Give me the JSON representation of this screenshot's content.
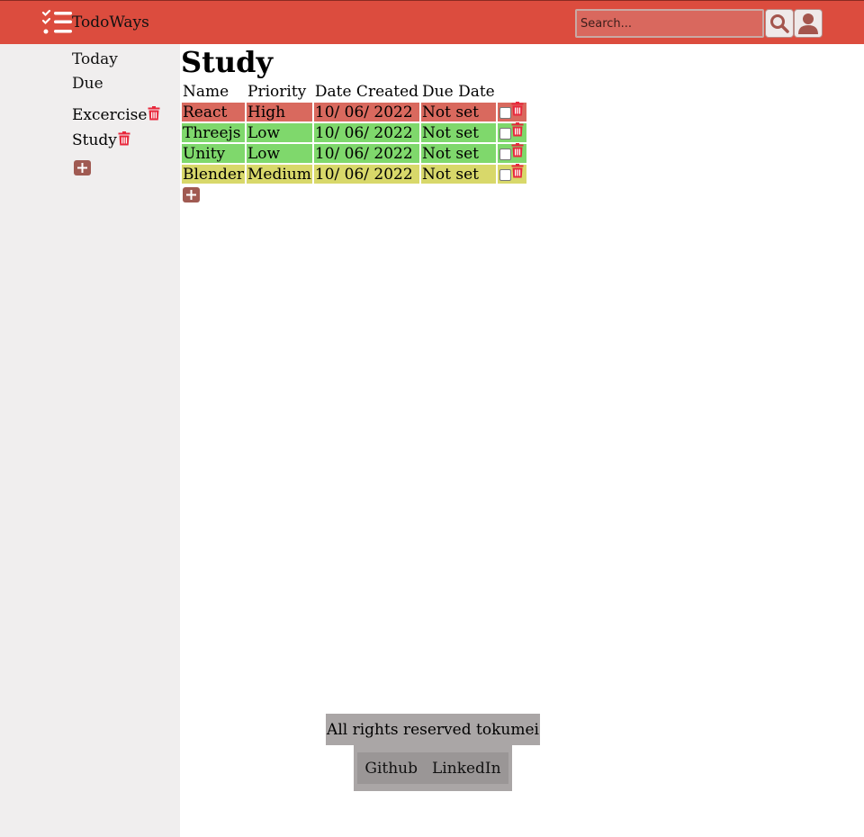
{
  "header": {
    "brand": "TodoWays",
    "search_placeholder": "Search..."
  },
  "sidebar": {
    "nav": [
      {
        "label": "Today"
      },
      {
        "label": "Due"
      }
    ],
    "projects": [
      {
        "label": "Excercise"
      },
      {
        "label": "Study"
      }
    ]
  },
  "main": {
    "title": "Study",
    "columns": [
      "Name",
      "Priority",
      "Date Created",
      "Due Date"
    ],
    "rows": [
      {
        "name": "React",
        "priority": "High",
        "date_created": "10/ 06/ 2022",
        "due_date": "Not set"
      },
      {
        "name": "Threejs",
        "priority": "Low",
        "date_created": "10/ 06/ 2022",
        "due_date": "Not set"
      },
      {
        "name": "Unity",
        "priority": "Low",
        "date_created": "10/ 06/ 2022",
        "due_date": "Not set"
      },
      {
        "name": "Blender",
        "priority": "Medium",
        "date_created": "10/ 06/ 2022",
        "due_date": "Not set"
      }
    ]
  },
  "footer": {
    "copyright": "All rights reserved tokumei",
    "links": [
      "Github",
      "LinkedIn"
    ]
  },
  "colors": {
    "header": "#dc4c3e",
    "high": "#d9695e",
    "low": "#7fd86c",
    "medium": "#d8d86a",
    "trash": "#e8283c"
  }
}
